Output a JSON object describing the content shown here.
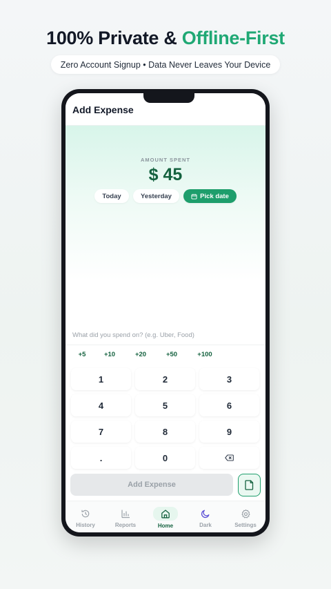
{
  "headline": {
    "prefix": "100% Private & ",
    "accent": "Offline-First"
  },
  "subtitle": "Zero Account Signup • Data Never Leaves Your Device",
  "colors": {
    "accent": "#1fa874",
    "primary": "#1e9e6c",
    "dark_green": "#14623f"
  },
  "app": {
    "title": "Add Expense",
    "amount_label": "AMOUNT SPENT",
    "amount": "$ 45",
    "date_chips": [
      {
        "label": "Today"
      },
      {
        "label": "Yesterday"
      },
      {
        "label": "Pick date",
        "icon": "calendar-icon",
        "selected": true
      }
    ],
    "description_placeholder": "What did you spend on? (e.g. Uber, Food)",
    "quick_amounts": [
      "+5",
      "+10",
      "+20",
      "+50",
      "+100"
    ],
    "keypad": [
      "1",
      "2",
      "3",
      "4",
      "5",
      "6",
      "7",
      "8",
      "9",
      ".",
      "0",
      "backspace-icon"
    ],
    "submit_label": "Add Expense",
    "attach_icon": "document-icon",
    "nav": [
      {
        "label": "History",
        "icon": "history-icon"
      },
      {
        "label": "Reports",
        "icon": "bar-chart-icon"
      },
      {
        "label": "Home",
        "icon": "home-icon",
        "active": true
      },
      {
        "label": "Dark",
        "icon": "moon-icon"
      },
      {
        "label": "Settings",
        "icon": "gear-icon"
      }
    ]
  }
}
